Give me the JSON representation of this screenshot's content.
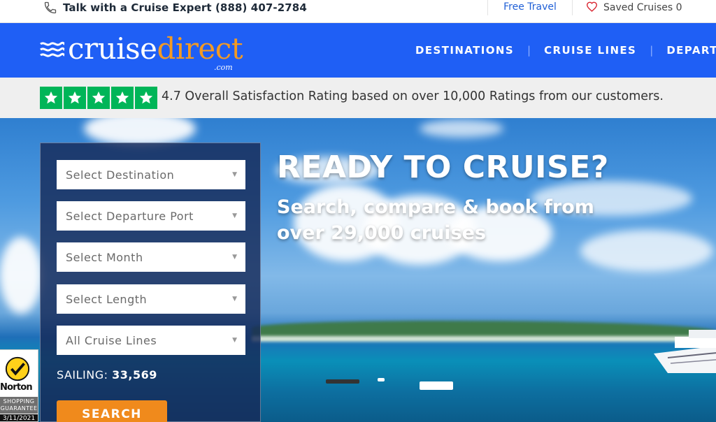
{
  "topbar": {
    "phone_label": "Talk with a Cruise Expert (888) 407-2784",
    "free_travel": "Free Travel",
    "saved_label": "Saved Cruises 0"
  },
  "nav": {
    "logo_cruise": "cruise",
    "logo_direct": "direct",
    "logo_com": ".com",
    "items": [
      "DESTINATIONS",
      "CRUISE LINES",
      "DEPART"
    ]
  },
  "rating": {
    "stars": 5,
    "text": "4.7 Overall Satisfaction Rating based on over 10,000 Ratings from our customers."
  },
  "hero": {
    "title": "READY TO CRUISE?",
    "subtitle": "Search, compare & book from over 29,000 cruises"
  },
  "search": {
    "selects": [
      "Select Destination",
      "Select Departure Port",
      "Select Month",
      "Select Length",
      "All Cruise Lines"
    ],
    "sailing_label": "SAILING:",
    "sailing_count": "33,569",
    "button": "SEARCH"
  },
  "norton": {
    "name": "Norton",
    "guarantee": "SHOPPING GUARANTEE",
    "date": "3/11/2021"
  },
  "colors": {
    "nav_blue": "#1f5ff5",
    "accent_orange": "#f08a1c",
    "trust_green": "#00b558",
    "link_blue": "#1f5fd6"
  },
  "icons": [
    "phone-icon",
    "heart-icon",
    "star-icon",
    "dropdown-caret-icon",
    "norton-check-icon"
  ]
}
